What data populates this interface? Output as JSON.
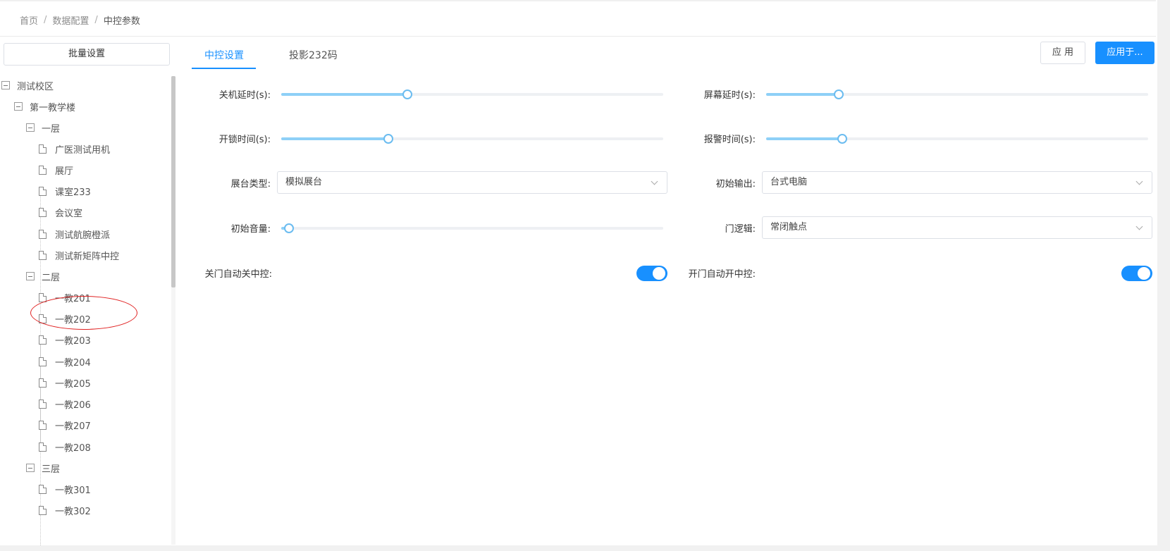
{
  "breadcrumb": {
    "items": [
      "首页",
      "数据配置",
      "中控参数"
    ],
    "separator": "/"
  },
  "sidebar": {
    "batch_button": "批量设置",
    "tree": {
      "root": "测试校区",
      "building": "第一教学楼",
      "floors": [
        {
          "label": "一层",
          "rooms": [
            "广医测试用机",
            "展厅",
            "课室233",
            "会议室",
            "测试航腕橙派",
            "测试新矩阵中控"
          ]
        },
        {
          "label": "二层",
          "rooms": [
            "一教201",
            "一教202",
            "一教203",
            "一教204",
            "一教205",
            "一教206",
            "一教207",
            "一教208"
          ]
        },
        {
          "label": "三层",
          "rooms": [
            "一教301",
            "一教302"
          ]
        }
      ]
    }
  },
  "tabs": [
    {
      "label": "中控设置",
      "active": true
    },
    {
      "label": "投影232码",
      "active": false
    }
  ],
  "actions": {
    "apply": "应 用",
    "apply_to": "应用于..."
  },
  "form": {
    "shutdown_delay": {
      "label": "关机延时(s):",
      "level": 0.33
    },
    "screen_delay": {
      "label": "屏幕延时(s):",
      "level": 0.19
    },
    "unlock_time": {
      "label": "开锁时间(s):",
      "level": 0.28
    },
    "alarm_time": {
      "label": "报警时间(s):",
      "level": 0.2
    },
    "platform_type": {
      "label": "展台类型:",
      "value": "模拟展台"
    },
    "initial_output": {
      "label": "初始输出:",
      "value": "台式电脑"
    },
    "initial_volume": {
      "label": "初始音量:",
      "level": 0.02
    },
    "door_logic": {
      "label": "门逻辑:",
      "value": "常闭触点"
    },
    "close_door_auto_off": {
      "label": "关门自动关中控:",
      "on": true
    },
    "open_door_auto_on": {
      "label": "开门自动开中控:",
      "on": true
    }
  },
  "colors": {
    "accent": "#1890ff",
    "slider_fill": "#8ed0f7",
    "highlight": "#e02020"
  }
}
